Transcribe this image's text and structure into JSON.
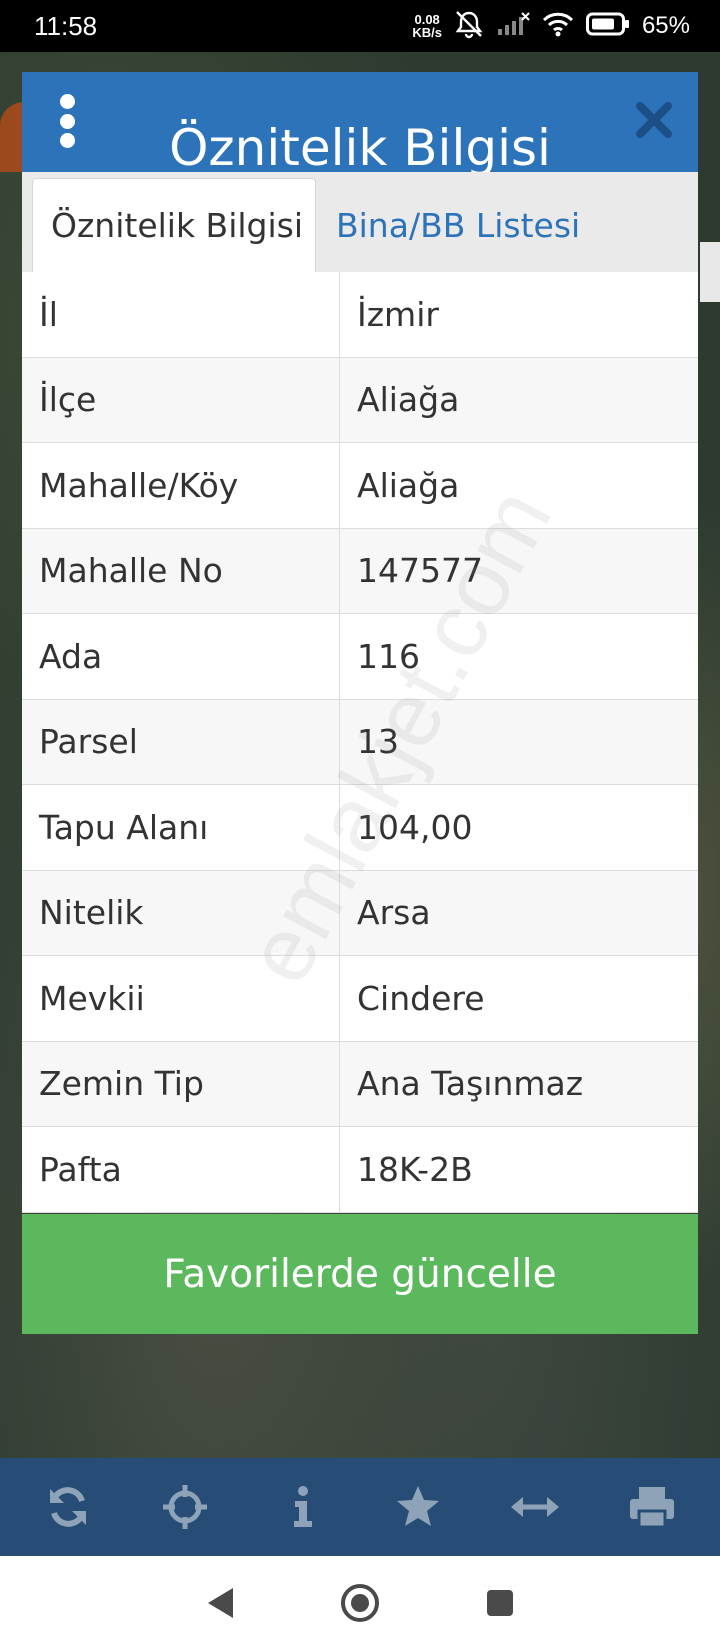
{
  "status_bar": {
    "time": "11:58",
    "net_speed_value": "0.08",
    "net_speed_unit": "KB/s",
    "battery_percent": "65%"
  },
  "dialog": {
    "title": "Öznitelik Bilgisi",
    "tabs": [
      {
        "label": "Öznitelik Bilgisi",
        "active": true
      },
      {
        "label": "Bina/BB Listesi",
        "active": false
      }
    ],
    "rows": [
      {
        "label": "İl",
        "value": "İzmir"
      },
      {
        "label": "İlçe",
        "value": "Aliağa"
      },
      {
        "label": "Mahalle/Köy",
        "value": "Aliağa"
      },
      {
        "label": "Mahalle No",
        "value": "147577"
      },
      {
        "label": "Ada",
        "value": "116"
      },
      {
        "label": "Parsel",
        "value": "13"
      },
      {
        "label": "Tapu Alanı",
        "value": "104,00"
      },
      {
        "label": "Nitelik",
        "value": "Arsa"
      },
      {
        "label": "Mevkii",
        "value": "Cindere"
      },
      {
        "label": "Zemin Tip",
        "value": "Ana Taşınmaz"
      },
      {
        "label": "Pafta",
        "value": "18K-2B"
      }
    ],
    "favorite_button": "Favorilerde güncelle"
  },
  "watermark": "emlakjet.com",
  "toolbar": {
    "icons": [
      "refresh-icon",
      "crosshair-icon",
      "info-icon",
      "star-icon",
      "resize-horizontal-icon",
      "print-icon"
    ]
  },
  "colors": {
    "header_blue": "#2d73b9",
    "toolbar_blue": "#274d76",
    "button_green": "#5cb85c"
  }
}
